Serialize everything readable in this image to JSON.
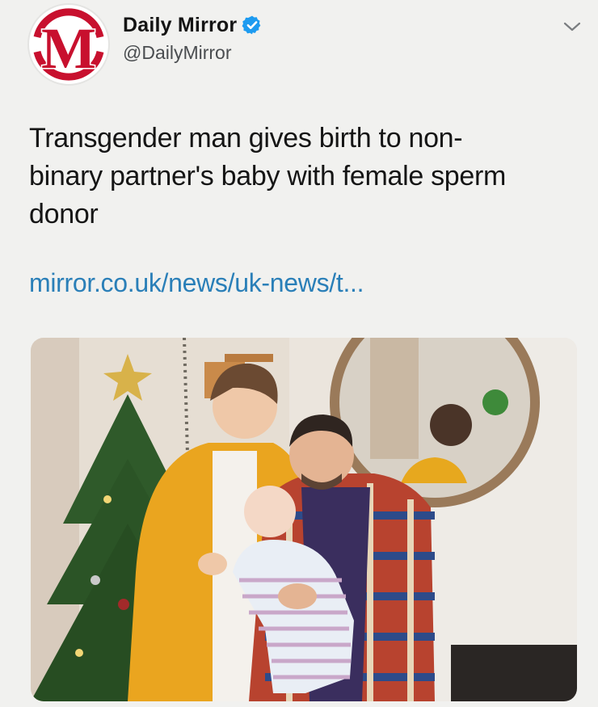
{
  "account": {
    "display_name": "Daily Mirror",
    "handle": "@DailyMirror",
    "avatar_letter": "M",
    "verified": true,
    "avatar_color": "#c8102e",
    "verified_color": "#1d9bf0"
  },
  "tweet": {
    "lines": [
      "Transgender man gives birth to non-",
      "binary partner's baby with female sperm",
      "donor"
    ],
    "link_text": "mirror.co.uk/news/uk-news/t..."
  },
  "icons": {
    "verified": "verified-badge-icon",
    "menu": "chevron-down-icon"
  },
  "colors": {
    "background": "#f1f1ef",
    "link": "#2a7fb8",
    "text": "#151515"
  }
}
